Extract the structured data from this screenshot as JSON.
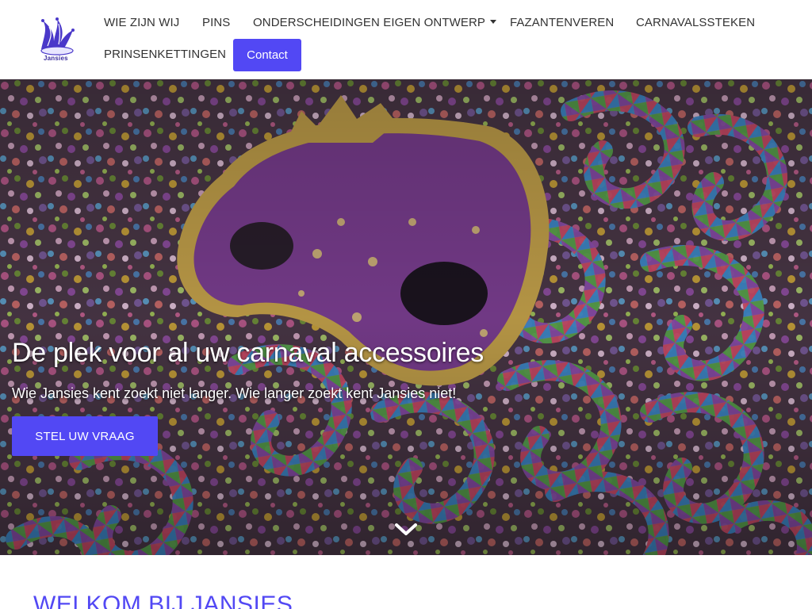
{
  "brand": {
    "logo_text": "Jansies",
    "accent": "#5248f4"
  },
  "nav": {
    "items": [
      {
        "label": "WIE ZIJN WIJ"
      },
      {
        "label": "PINS"
      },
      {
        "label": "ONDERSCHEIDINGEN EIGEN ONTWERP",
        "dropdown": true
      },
      {
        "label": "FAZANTENVEREN"
      },
      {
        "label": "CARNAVALSSTEKEN"
      },
      {
        "label": "PRINSENKETTINGEN"
      }
    ],
    "contact_label": "Contact"
  },
  "hero": {
    "title": "De plek voor al uw carnaval accessoires",
    "subtitle": "Wie Jansies kent zoekt niet langer. Wie langer zoekt kent Jansies niet!",
    "button_label": "STEL UW VRAAG",
    "scroll_icon": "chevron-down-icon"
  },
  "welcome": {
    "heading": "WELKOM BIJ JANSIES"
  }
}
